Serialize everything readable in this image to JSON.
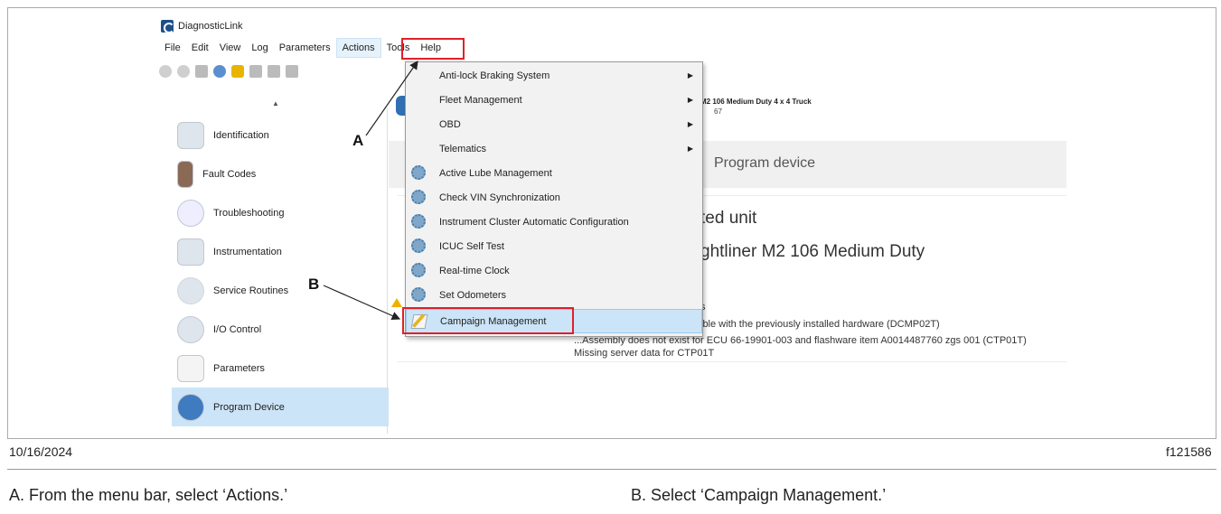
{
  "app": {
    "title": "DiagnosticLink",
    "menu": [
      "File",
      "Edit",
      "View",
      "Log",
      "Parameters",
      "Actions",
      "Tools",
      "Help"
    ]
  },
  "sidebar": {
    "items": [
      {
        "label": "Identification",
        "icon": "identification-icon"
      },
      {
        "label": "Fault Codes",
        "icon": "fault-codes-icon"
      },
      {
        "label": "Troubleshooting",
        "icon": "stethoscope-icon"
      },
      {
        "label": "Instrumentation",
        "icon": "instrumentation-icon"
      },
      {
        "label": "Service Routines",
        "icon": "gears-icon"
      },
      {
        "label": "I/O Control",
        "icon": "io-control-icon"
      },
      {
        "label": "Parameters",
        "icon": "parameters-icon"
      },
      {
        "label": "Program Device",
        "icon": "program-device-icon"
      }
    ]
  },
  "actions_menu": {
    "items": [
      {
        "label": "Anti-lock Braking System",
        "submenu": true
      },
      {
        "label": "Fleet Management",
        "submenu": true
      },
      {
        "label": "OBD",
        "submenu": true
      },
      {
        "label": "Telematics",
        "submenu": true
      },
      {
        "label": "Active Lube Management",
        "icon": "gear-icon"
      },
      {
        "label": "Check VIN Synchronization",
        "icon": "gear-icon"
      },
      {
        "label": "Instrument Cluster Automatic Configuration",
        "icon": "gear-icon"
      },
      {
        "label": "ICUC Self Test",
        "icon": "gear-icon"
      },
      {
        "label": "Real-time Clock",
        "icon": "gear-icon"
      },
      {
        "label": "Set Odometers",
        "icon": "gear-icon"
      },
      {
        "label": "Campaign Management",
        "icon": "pencil-icon"
      }
    ]
  },
  "main": {
    "vehicle_line1": "M2 106 Medium Duty 4 x 4 Truck",
    "vehicle_line2": "67",
    "program_device_title": "Program device",
    "unit_partial": "ted unit",
    "model_partial": "ghtliner M2 106 Medium Duty",
    "error_line1": "s",
    "error_line2": "ible with the previously installed hardware (DCMP02T)",
    "error_line3": "...Assembly does not exist for ECU 66-19901-003 and flashware item A0014487760 zgs 001 (CTP01T)",
    "error_line4": "Missing server data for CTP01T"
  },
  "figure": {
    "date": "10/16/2024",
    "figure_id": "f121586",
    "callout_a": "A",
    "callout_b": "B",
    "caption_a": "A. From the menu bar, select ‘Actions.’",
    "caption_b": "B. Select ‘Campaign Management.’"
  },
  "colors": {
    "highlight": "#e0202a",
    "selection": "#cce4f7"
  }
}
